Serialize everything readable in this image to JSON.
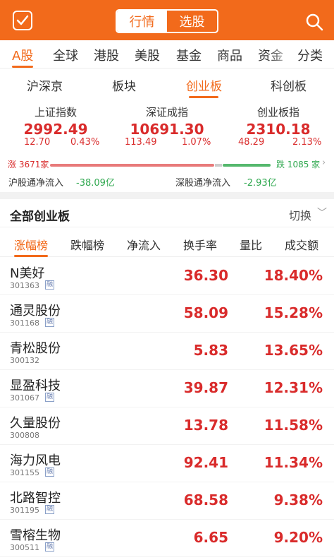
{
  "header": {
    "tab_market": "行情",
    "tab_select": "选股",
    "check_icon": "check-icon",
    "search_icon": "search-icon",
    "brand_color": "#f26a1b"
  },
  "nav": [
    "A股",
    "全球",
    "港股",
    "美股",
    "基金",
    "商品",
    "资金",
    "分类"
  ],
  "subtabs": [
    "沪深京",
    "板块",
    "创业板",
    "科创板"
  ],
  "indices": [
    {
      "name": "上证指数",
      "value": "2992.49",
      "change": "12.70",
      "pct": "0.43%"
    },
    {
      "name": "深证成指",
      "value": "10691.30",
      "change": "113.49",
      "pct": "1.07%"
    },
    {
      "name": "创业板指",
      "value": "2310.18",
      "change": "48.29",
      "pct": "2.13%"
    }
  ],
  "breadth": {
    "up": "涨 3671家",
    "down": "跌 1085 家"
  },
  "flows": {
    "sh_label": "沪股通净流入",
    "sh_value": "-38.09亿",
    "sz_label": "深股通净流入",
    "sz_value": "-2.93亿"
  },
  "section": {
    "title": "全部创业板",
    "switch": "切换"
  },
  "rank_tabs": [
    "涨幅榜",
    "跌幅榜",
    "净流入",
    "换手率",
    "量比",
    "成交额"
  ],
  "stocks": [
    {
      "name": "N美好",
      "code": "301363",
      "badge": "融",
      "price": "36.30",
      "pct": "18.40%"
    },
    {
      "name": "通灵股份",
      "code": "301168",
      "badge": "融",
      "price": "58.09",
      "pct": "15.28%"
    },
    {
      "name": "青松股份",
      "code": "300132",
      "badge": "",
      "price": "5.83",
      "pct": "13.65%"
    },
    {
      "name": "显盈科技",
      "code": "301067",
      "badge": "融",
      "price": "39.87",
      "pct": "12.31%"
    },
    {
      "name": "久量股份",
      "code": "300808",
      "badge": "",
      "price": "13.78",
      "pct": "11.58%"
    },
    {
      "name": "海力风电",
      "code": "301155",
      "badge": "融",
      "price": "92.41",
      "pct": "11.34%"
    },
    {
      "name": "北路智控",
      "code": "301195",
      "badge": "融",
      "price": "68.58",
      "pct": "9.38%"
    },
    {
      "name": "雪榕生物",
      "code": "300511",
      "badge": "融",
      "price": "6.65",
      "pct": "9.20%"
    }
  ]
}
